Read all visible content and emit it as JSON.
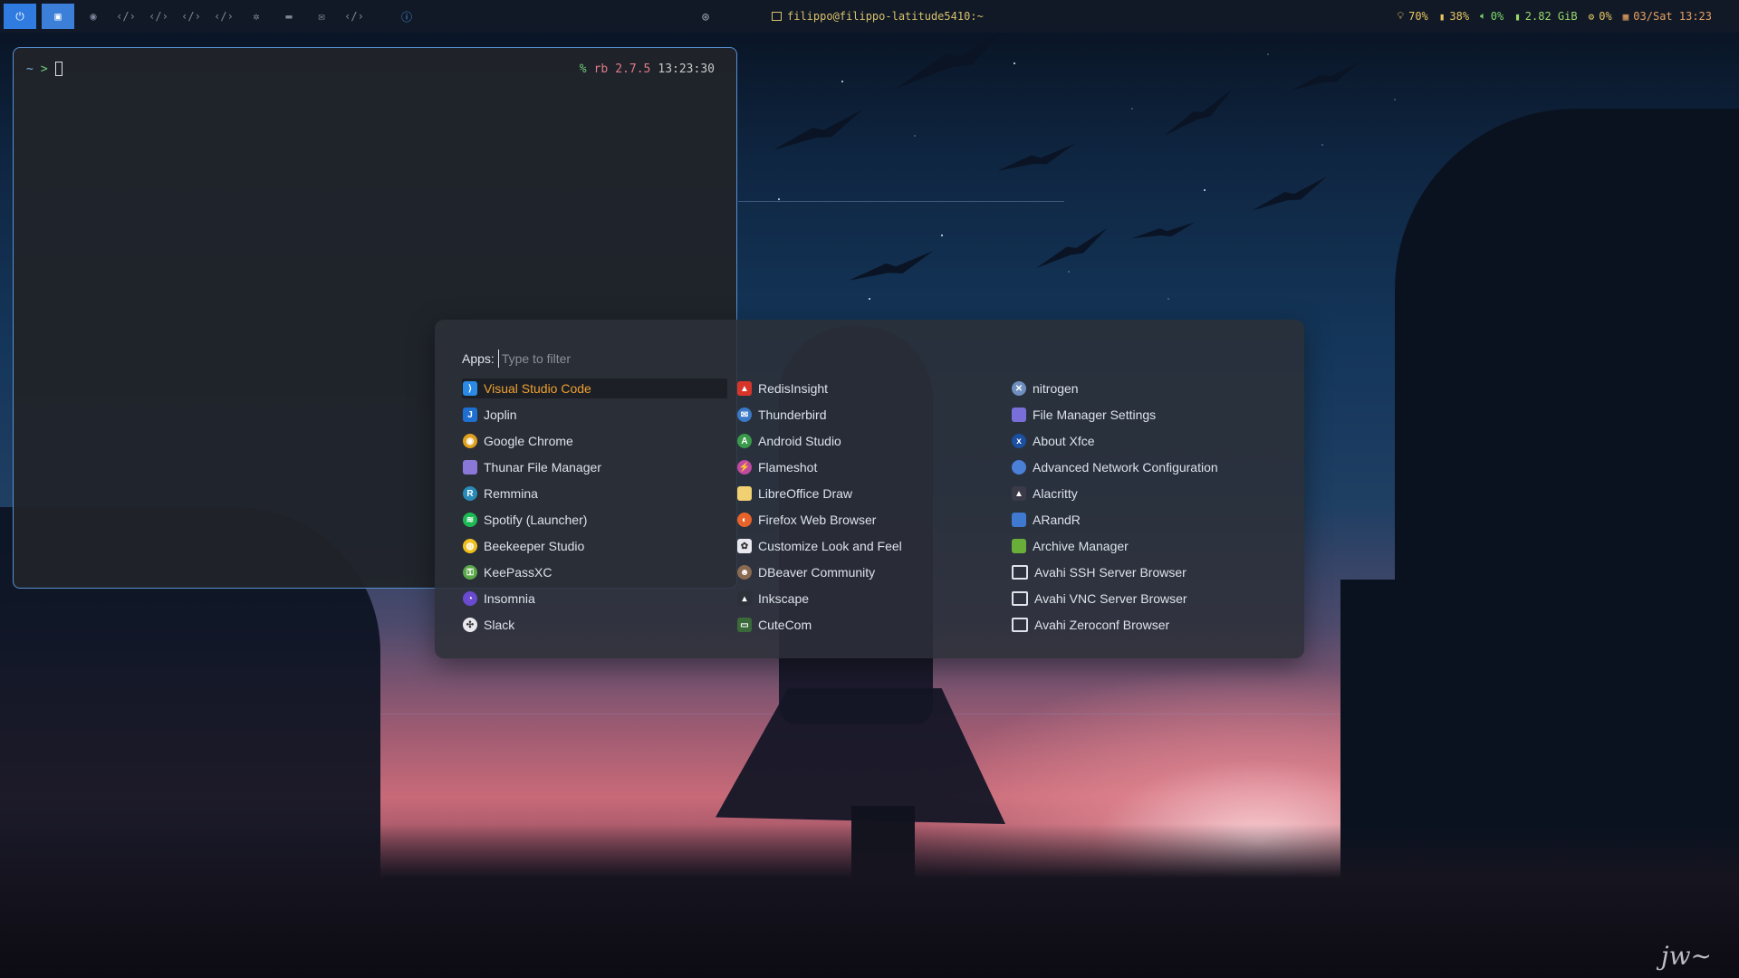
{
  "topbar": {
    "workspace_buttons": [
      {
        "name": "power-button",
        "glyph": "⏻",
        "state": "power"
      },
      {
        "name": "terminal-workspace-button",
        "glyph": "▣",
        "state": "active"
      },
      {
        "name": "browser-workspace-button",
        "glyph": "◉",
        "state": "normal"
      },
      {
        "name": "code-workspace-1-button",
        "glyph": "‹/›",
        "state": "dim"
      },
      {
        "name": "code-workspace-2-button",
        "glyph": "‹/›",
        "state": "dim"
      },
      {
        "name": "code-workspace-3-button",
        "glyph": "‹/›",
        "state": "dim"
      },
      {
        "name": "code-workspace-4-button",
        "glyph": "‹/›",
        "state": "dim"
      },
      {
        "name": "gear-workspace-button",
        "glyph": "✲",
        "state": "dim"
      },
      {
        "name": "folder-workspace-button",
        "glyph": "▬",
        "state": "dim"
      },
      {
        "name": "mail-workspace-button",
        "glyph": "✉",
        "state": "dim"
      },
      {
        "name": "code-workspace-5-button",
        "glyph": "‹/›",
        "state": "dim"
      },
      {
        "name": "info-workspace-button",
        "glyph": "ⓘ",
        "state": "accent"
      },
      {
        "name": "github-workspace-button",
        "glyph": "◎",
        "state": "gh"
      }
    ],
    "window_title": "filippo@filippo-latitude5410:~",
    "stats": {
      "brightness": "70%",
      "battery": "38%",
      "volume": "0%",
      "memory": "2.82 GiB",
      "cpu": "0%",
      "datetime": "03/Sat 13:23"
    }
  },
  "terminal": {
    "prompt_path": "~",
    "prompt_arrow": ">",
    "rprompt_symbol": "%",
    "rprompt_ruby": "rb",
    "rprompt_version": "2.7.5",
    "rprompt_time": "13:23:30"
  },
  "launcher": {
    "label": "Apps:",
    "placeholder": "Type to filter",
    "apps": [
      {
        "label": "Visual Studio Code",
        "icon": "vscode-icon",
        "color": "#2b8ae6",
        "glyph": "⟩",
        "selected": true
      },
      {
        "label": "RedisInsight",
        "icon": "redisinsight-icon",
        "color": "#d8352a",
        "glyph": "▲"
      },
      {
        "label": "nitrogen",
        "icon": "nitrogen-icon",
        "color": "#6f8fbf",
        "glyph": "✕",
        "round": true
      },
      {
        "label": "Joplin",
        "icon": "joplin-icon",
        "color": "#1f6fd0",
        "glyph": "J"
      },
      {
        "label": "Thunderbird",
        "icon": "thunderbird-icon",
        "color": "#3a78c8",
        "glyph": "✉",
        "round": true
      },
      {
        "label": "File Manager Settings",
        "icon": "file-manager-settings-icon",
        "color": "#7a6fd8",
        "glyph": ""
      },
      {
        "label": "Google Chrome",
        "icon": "chrome-icon",
        "color": "#e0a020",
        "glyph": "◉",
        "round": true
      },
      {
        "label": "Android Studio",
        "icon": "android-studio-icon",
        "color": "#3a9a4a",
        "glyph": "A",
        "round": true
      },
      {
        "label": "About Xfce",
        "icon": "xfce-icon",
        "color": "#1b4fa0",
        "glyph": "x",
        "round": true
      },
      {
        "label": "Thunar File Manager",
        "icon": "thunar-icon",
        "color": "#8a78d8",
        "glyph": ""
      },
      {
        "label": "Flameshot",
        "icon": "flameshot-icon",
        "color": "#c04aa0",
        "glyph": "⚡",
        "round": true
      },
      {
        "label": "Advanced Network Configuration",
        "icon": "network-config-icon",
        "color": "#4a80d8",
        "glyph": "",
        "round": true
      },
      {
        "label": "Remmina",
        "icon": "remmina-icon",
        "color": "#2a8ab8",
        "glyph": "R",
        "round": true
      },
      {
        "label": "LibreOffice Draw",
        "icon": "libreoffice-draw-icon",
        "color": "#f0d070",
        "glyph": ""
      },
      {
        "label": "Alacritty",
        "icon": "alacritty-icon",
        "color": "#3a3a48",
        "glyph": "▲"
      },
      {
        "label": "Spotify (Launcher)",
        "icon": "spotify-icon",
        "color": "#1db954",
        "glyph": "≋",
        "round": true
      },
      {
        "label": "Firefox Web Browser",
        "icon": "firefox-icon",
        "color": "#e8632a",
        "glyph": "◐",
        "round": true
      },
      {
        "label": "ARandR",
        "icon": "arandr-icon",
        "color": "#3f7ad0",
        "glyph": ""
      },
      {
        "label": "Beekeeper Studio",
        "icon": "beekeeper-icon",
        "color": "#f0c020",
        "glyph": "◍",
        "round": true
      },
      {
        "label": "Customize Look and Feel",
        "icon": "customize-look-icon",
        "color": "#e8e8ee",
        "glyph": "✿"
      },
      {
        "label": "Archive Manager",
        "icon": "archive-manager-icon",
        "color": "#6aae3a",
        "glyph": ""
      },
      {
        "label": "KeePassXC",
        "icon": "keepassxc-icon",
        "color": "#5aa84a",
        "glyph": "⚿",
        "round": true
      },
      {
        "label": "DBeaver Community",
        "icon": "dbeaver-icon",
        "color": "#8a6a50",
        "glyph": "☻",
        "round": true
      },
      {
        "label": "Avahi SSH Server Browser",
        "icon": "avahi-ssh-icon",
        "color": "#dfe3ea",
        "glyph": "",
        "outline": true
      },
      {
        "label": "Insomnia",
        "icon": "insomnia-icon",
        "color": "#6a4ad0",
        "glyph": "◔",
        "round": true
      },
      {
        "label": "Inkscape",
        "icon": "inkscape-icon",
        "color": "#2c3038",
        "glyph": "▴"
      },
      {
        "label": "Avahi VNC Server Browser",
        "icon": "avahi-vnc-icon",
        "color": "#dfe3ea",
        "glyph": "",
        "outline": true
      },
      {
        "label": "Slack",
        "icon": "slack-icon",
        "color": "#e8e8ee",
        "glyph": "✣",
        "round": true
      },
      {
        "label": "CuteCom",
        "icon": "cutecom-icon",
        "color": "#3a6a3a",
        "glyph": "▭"
      },
      {
        "label": "Avahi Zeroconf Browser",
        "icon": "avahi-zeroconf-icon",
        "color": "#dfe3ea",
        "glyph": "",
        "outline": true
      }
    ]
  },
  "wallpaper": {
    "signature": "jw~"
  }
}
